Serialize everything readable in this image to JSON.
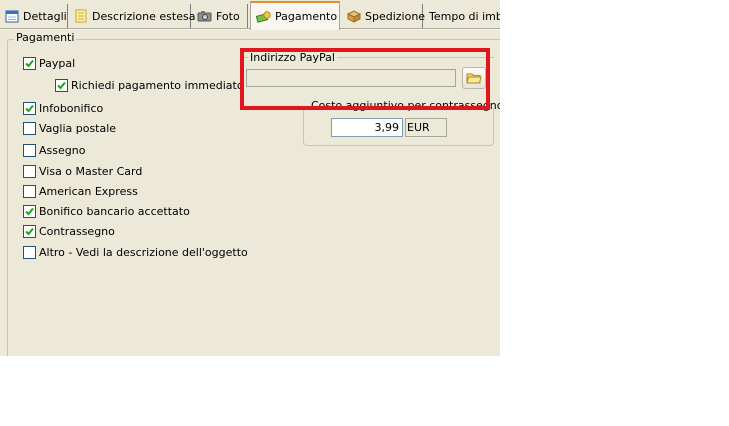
{
  "tabs": [
    {
      "label": "Dettagli",
      "icon": "calendar-icon"
    },
    {
      "label": "Descrizione estesa",
      "icon": "notepad-icon"
    },
    {
      "label": "Foto",
      "icon": "camera-icon"
    },
    {
      "label": "Pagamento",
      "icon": "money-icon",
      "active": true
    },
    {
      "label": "Spedizione",
      "icon": "package-icon"
    },
    {
      "label": "Tempo di imbal"
    }
  ],
  "payments": {
    "group_label": "Pagamenti",
    "options": [
      {
        "label": "Paypal",
        "checked": true
      },
      {
        "label": "Richiedi pagamento immediato",
        "checked": true
      },
      {
        "label": "Infobonifico",
        "checked": true
      },
      {
        "label": "Vaglia postale",
        "checked": false
      },
      {
        "label": "Assegno",
        "checked": false
      },
      {
        "label": "Visa o Master Card",
        "checked": false
      },
      {
        "label": "American Express",
        "checked": false
      },
      {
        "label": "Bonifico bancario accettato",
        "checked": true
      },
      {
        "label": "Contrassegno",
        "checked": true
      },
      {
        "label": "Altro - Vedi la descrizione dell'oggetto",
        "checked": false
      }
    ]
  },
  "paypal": {
    "group_label": "Indirizzo PayPal",
    "address_value": "",
    "browse_icon": "folder-icon"
  },
  "cod_surcharge": {
    "group_label": "Costo aggiuntivo per contrassegno",
    "amount": "3,99",
    "currency": "EUR"
  },
  "colors": {
    "highlight": "#e0161e",
    "active_tab_accent": "#e68b2c",
    "dialog_bg": "#ece9d8"
  }
}
